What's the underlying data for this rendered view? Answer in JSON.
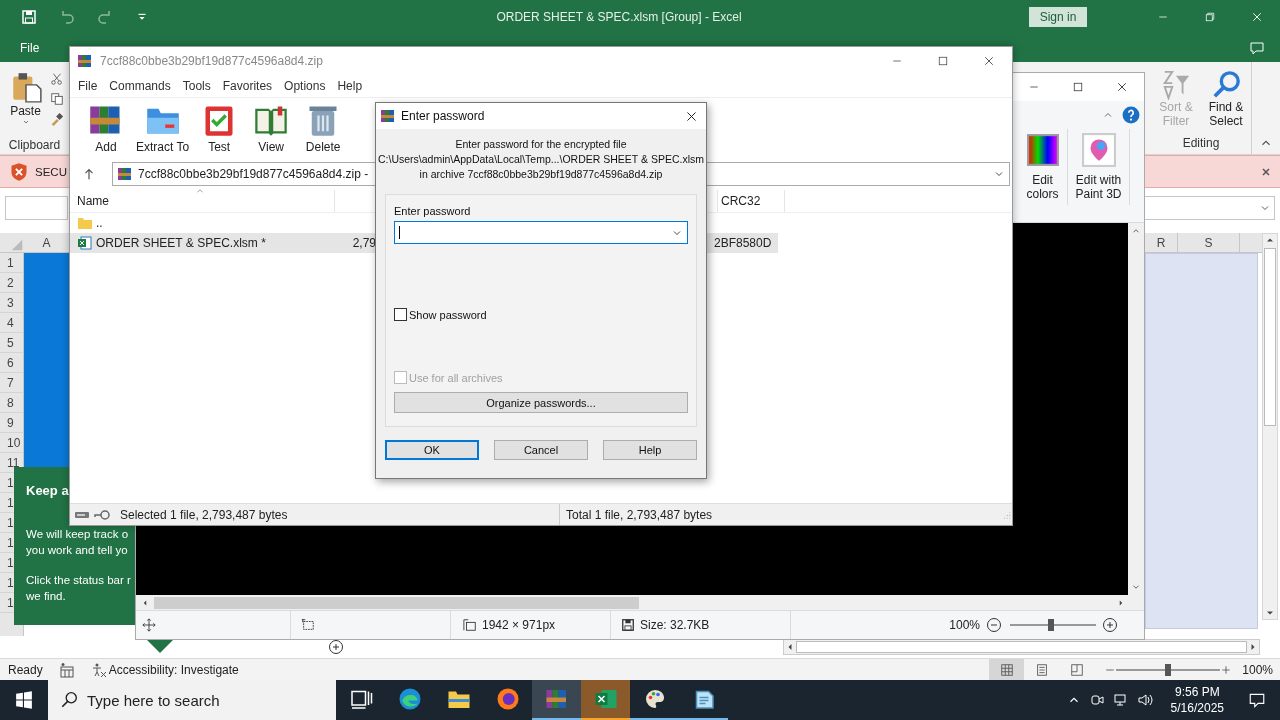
{
  "excel": {
    "title": "ORDER SHEET & SPEC.xlsm  [Group]  -  Excel",
    "sign_in": "Sign in",
    "file_tab": "File",
    "clipboard": {
      "paste": "Paste",
      "group": "Clipboard"
    },
    "editing": {
      "sort_filter": "Sort & Filter",
      "sort_filter_disabled": true,
      "find_select": "Find & Select",
      "group": "Editing"
    },
    "security_bar": "SECU",
    "columns_left": [
      "A"
    ],
    "columns_right": [
      "R",
      "S"
    ],
    "rows": [
      "1",
      "2",
      "3",
      "4",
      "5",
      "6",
      "7",
      "8",
      "9",
      "10",
      "11",
      "1",
      "1",
      "1",
      "1",
      "1",
      "1",
      "1"
    ],
    "status": "Ready",
    "accessibility": "Accessibility: Investigate",
    "views": [
      {
        "kind": "normal",
        "selected": true
      },
      {
        "kind": "page_layout",
        "selected": false
      },
      {
        "kind": "page_break",
        "selected": false
      }
    ],
    "zoom": "100%",
    "zoom_slider": {
      "level": 0.5
    }
  },
  "tip": {
    "title": "Keep a",
    "paragraphs": [
      [
        "We will keep track o",
        "you work and tell yo"
      ],
      [
        "Click the status bar r",
        "we find."
      ]
    ]
  },
  "paint": {
    "edit_colors": "Edit colors",
    "paint3d": "Edit with Paint 3D",
    "dimensions": "1942 × 971px",
    "size": "Size: 32.7KB",
    "zoom": "100%",
    "zoom_slider": {
      "level": 0.48
    }
  },
  "archiver": {
    "title": "7ccf88c0bbe3b29bf19d877c4596a8d4.zip",
    "menu": [
      "File",
      "Commands",
      "Tools",
      "Favorites",
      "Options",
      "Help"
    ],
    "toolbar": [
      {
        "kind": "add",
        "label": "Add"
      },
      {
        "kind": "extract",
        "label": "Extract To"
      },
      {
        "kind": "test",
        "label": "Test"
      },
      {
        "kind": "view",
        "label": "View"
      },
      {
        "kind": "delete",
        "label": "Delete"
      }
    ],
    "path": "7ccf88c0bbe3b29bf19d877c4596a8d4.zip -",
    "columns": {
      "name": "Name",
      "crc": "CRC32"
    },
    "rows": [
      {
        "kind": "folder",
        "name": "..",
        "selected": false
      },
      {
        "kind": "file",
        "name": "ORDER SHEET & SPEC.xlsm *",
        "size": "2,79",
        "crc": "2BF8580D",
        "selected": true
      }
    ],
    "status_left": "Selected 1 file, 2,793,487 bytes",
    "status_right": "Total 1 file, 2,793,487 bytes"
  },
  "dialog": {
    "title": "Enter password",
    "message": [
      "Enter password for the encrypted file",
      "C:\\Users\\admin\\AppData\\Local\\Temp...\\ORDER SHEET & SPEC.xlsm",
      "in archive 7ccf88c0bbe3b29bf19d877c4596a8d4.zip"
    ],
    "field_label": "Enter password",
    "show_password": {
      "label": "Show password",
      "checked": false
    },
    "use_for_all": {
      "label": "Use for all archives",
      "checked": false,
      "disabled": true
    },
    "organize": "Organize passwords...",
    "buttons": [
      {
        "label": "OK",
        "default": true
      },
      {
        "label": "Cancel",
        "default": false
      },
      {
        "label": "Help",
        "default": false
      }
    ]
  },
  "taskbar": {
    "search_placeholder": "Type here to search",
    "apps": [
      {
        "kind": "task_view",
        "running": false,
        "selected": false,
        "attention": false
      },
      {
        "kind": "edge",
        "running": false,
        "selected": false,
        "attention": false
      },
      {
        "kind": "explorer",
        "running": false,
        "selected": false,
        "attention": false
      },
      {
        "kind": "firefox",
        "running": false,
        "selected": false,
        "attention": false
      },
      {
        "kind": "winrar",
        "running": true,
        "selected": true,
        "attention": false
      },
      {
        "kind": "excel",
        "running": true,
        "selected": false,
        "attention": true
      },
      {
        "kind": "paint",
        "running": true,
        "selected": false,
        "attention": false
      },
      {
        "kind": "notepad",
        "running": true,
        "selected": false,
        "attention": false
      }
    ],
    "time": "9:56 PM",
    "date": "5/16/2025"
  }
}
